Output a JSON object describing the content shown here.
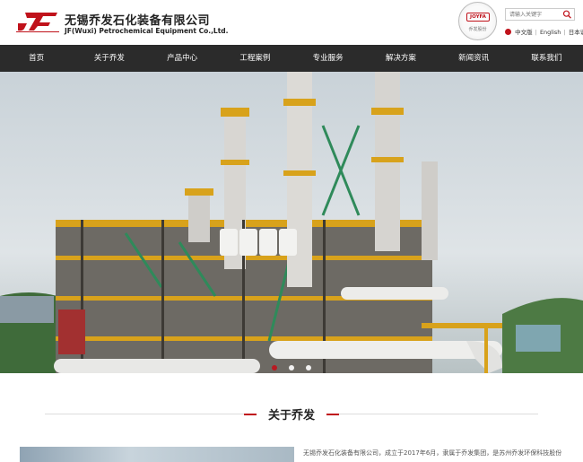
{
  "header": {
    "logo_mark": "JF",
    "company_cn": "无锡乔发石化装备有限公司",
    "company_en": "JF(Wuxi) Petrochemical Equipment Co.,Ltd.",
    "seal_logo": "JOYFA",
    "seal_text": "乔发股份",
    "search_placeholder": "请输入关键字",
    "languages": [
      "中文版",
      "English",
      "日本语"
    ]
  },
  "nav": {
    "items": [
      "首页",
      "关于乔发",
      "产品中心",
      "工程案例",
      "专业服务",
      "解决方案",
      "新闻资讯",
      "联系我们"
    ]
  },
  "hero": {
    "slides": 3,
    "active_slide": 1
  },
  "about": {
    "title": "关于乔发",
    "text": "无锡乔发石化装备有限公司，成立于2017年6月，隶属于乔发集团，是苏州乔发环保科技股份"
  },
  "colors": {
    "accent": "#c0121b",
    "nav_bg": "#2b2b2b"
  }
}
